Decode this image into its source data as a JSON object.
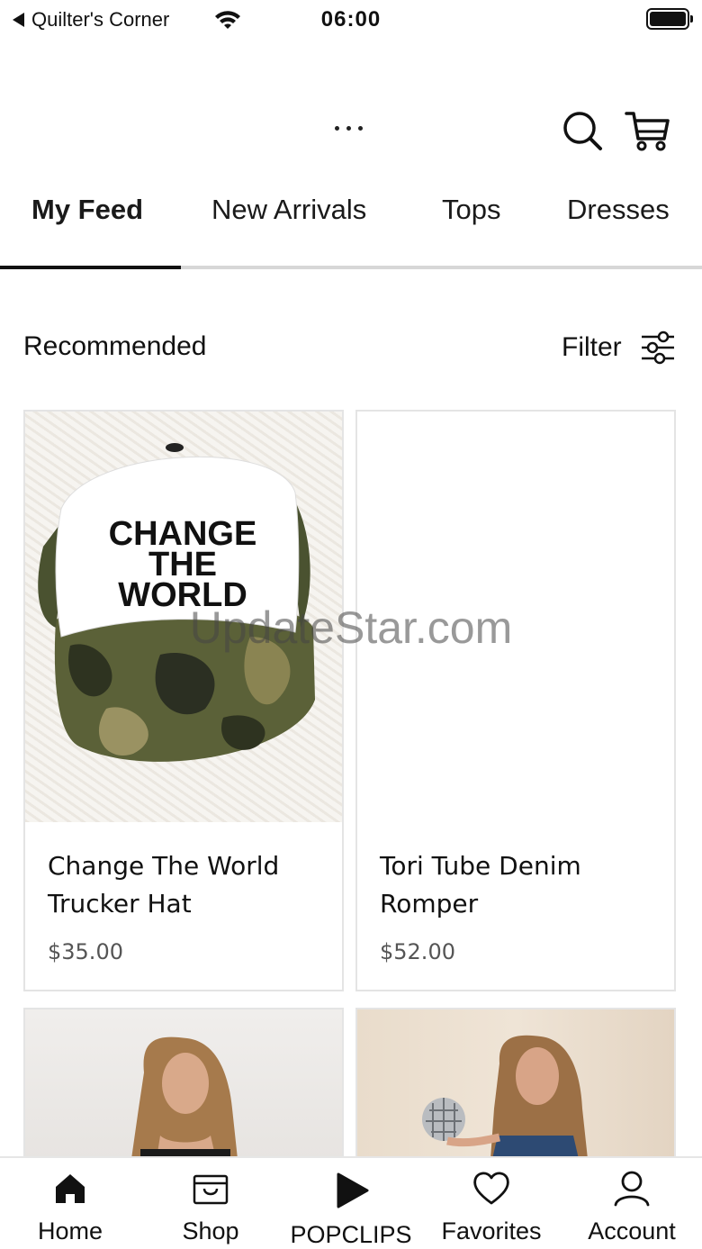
{
  "status_bar": {
    "back_label": "Quilter's Corner",
    "time": "06:00"
  },
  "header": {
    "icons": [
      "more-icon",
      "search-icon",
      "cart-icon"
    ]
  },
  "tabs": [
    {
      "label": "My Feed",
      "active": true
    },
    {
      "label": "New Arrivals",
      "active": false
    },
    {
      "label": "Tops",
      "active": false
    },
    {
      "label": "Dresses",
      "active": false
    }
  ],
  "section": {
    "title": "Recommended",
    "filter_label": "Filter"
  },
  "products": [
    {
      "name": "Change The World Trucker Hat",
      "price": "$35.00",
      "hat_text": [
        "CHANGE",
        "THE",
        "WORLD"
      ]
    },
    {
      "name": "Tori Tube Denim Romper",
      "price": "$52.00"
    }
  ],
  "watermark": "UpdateStar.com",
  "bottom_nav": [
    {
      "label": "Home",
      "icon": "home-icon"
    },
    {
      "label": "Shop",
      "icon": "shop-bag-icon"
    },
    {
      "label": "POPCLIPS",
      "icon": "play-icon"
    },
    {
      "label": "Favorites",
      "icon": "heart-icon"
    },
    {
      "label": "Account",
      "icon": "person-icon"
    }
  ],
  "colors": {
    "text": "#111111",
    "divider": "#d7d7d7",
    "price": "#555555"
  }
}
